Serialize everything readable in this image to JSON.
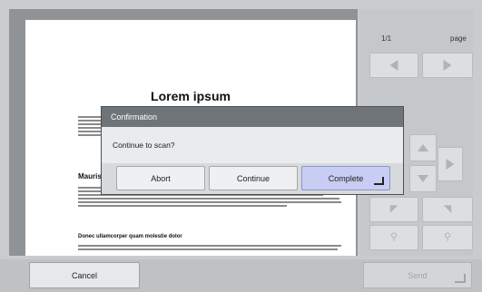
{
  "document": {
    "title": "Lorem ipsum",
    "heading1": "Mauris",
    "heading2": "Donec ullamcorper quam molestie dolor"
  },
  "side_panel": {
    "page_count": "1/1",
    "page_label": "page"
  },
  "dialog": {
    "title": "Confirmation",
    "message": "Continue to scan?",
    "abort_label": "Abort",
    "continue_label": "Continue",
    "complete_label": "Complete"
  },
  "footer": {
    "cancel_label": "Cancel",
    "send_label": "Send"
  },
  "icons": {
    "prev": "triangle-left",
    "next": "triangle-right",
    "scroll_up": "triangle-up",
    "scroll_down": "triangle-down",
    "scroll_right": "triangle-right",
    "rotate_left": "rotate-left",
    "rotate_right": "rotate-right",
    "zoom_out": "magnifier-minus",
    "zoom_in": "magnifier-plus",
    "enter": "enter-corner"
  },
  "colors": {
    "dialog_primary": "#c8cdf3",
    "dialog_title_bar": "#6f7479"
  }
}
